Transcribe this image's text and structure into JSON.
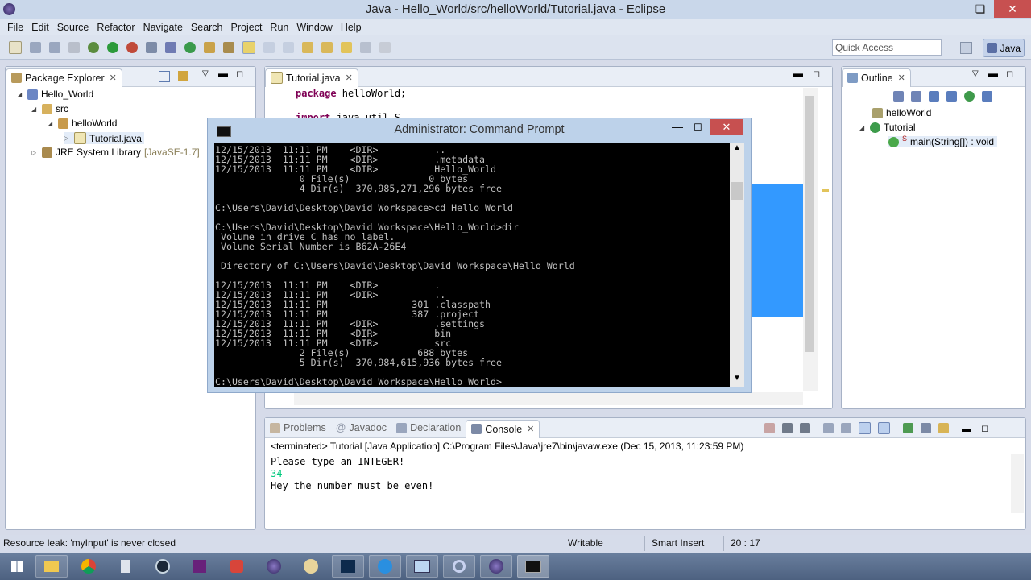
{
  "window": {
    "title": "Java - Hello_World/src/helloWorld/Tutorial.java - Eclipse"
  },
  "menu": [
    "File",
    "Edit",
    "Source",
    "Refactor",
    "Navigate",
    "Search",
    "Project",
    "Run",
    "Window",
    "Help"
  ],
  "toolbar": {
    "quick_access_placeholder": "Quick Access",
    "perspective": "Java"
  },
  "package_explorer": {
    "title": "Package Explorer",
    "items": [
      {
        "label": "Hello_World"
      },
      {
        "label": "src"
      },
      {
        "label": "helloWorld"
      },
      {
        "label": "Tutorial.java"
      },
      {
        "label": "JRE System Library",
        "decoration": "[JavaSE-1.7]"
      }
    ]
  },
  "editor": {
    "tab": "Tutorial.java",
    "lines": [
      {
        "keyword": "package",
        "text": " helloWorld;"
      },
      {
        "keyword": "import",
        "text": " java.util.S"
      }
    ]
  },
  "outline": {
    "title": "Outline",
    "items": [
      {
        "label": "helloWorld"
      },
      {
        "label": "Tutorial"
      },
      {
        "label": "main(String[]) : void",
        "modifier": "S"
      }
    ]
  },
  "command_prompt": {
    "title": "Administrator: Command Prompt",
    "lines": [
      "12/15/2013  11:11 PM    <DIR>          ..",
      "12/15/2013  11:11 PM    <DIR>          .metadata",
      "12/15/2013  11:11 PM    <DIR>          Hello_World",
      "               0 File(s)              0 bytes",
      "               4 Dir(s)  370,985,271,296 bytes free",
      "",
      "C:\\Users\\David\\Desktop\\David Workspace>cd Hello_World",
      "",
      "C:\\Users\\David\\Desktop\\David Workspace\\Hello_World>dir",
      " Volume in drive C has no label.",
      " Volume Serial Number is B62A-26E4",
      "",
      " Directory of C:\\Users\\David\\Desktop\\David Workspace\\Hello_World",
      "",
      "12/15/2013  11:11 PM    <DIR>          .",
      "12/15/2013  11:11 PM    <DIR>          ..",
      "12/15/2013  11:11 PM               301 .classpath",
      "12/15/2013  11:11 PM               387 .project",
      "12/15/2013  11:11 PM    <DIR>          .settings",
      "12/15/2013  11:11 PM    <DIR>          bin",
      "12/15/2013  11:11 PM    <DIR>          src",
      "               2 File(s)            688 bytes",
      "               5 Dir(s)  370,984,615,936 bytes free",
      "",
      "C:\\Users\\David\\Desktop\\David Workspace\\Hello_World>"
    ]
  },
  "bottom_panel": {
    "tabs": [
      "Problems",
      "Javadoc",
      "Declaration",
      "Console"
    ],
    "status_line": "<terminated> Tutorial [Java Application] C:\\Program Files\\Java\\jre7\\bin\\javaw.exe (Dec 15, 2013, 11:23:59 PM)",
    "output": [
      {
        "text": "Please type an INTEGER!",
        "kind": "stdout"
      },
      {
        "text": "34",
        "kind": "stdin"
      },
      {
        "text": "Hey the number must be even!",
        "kind": "stdout"
      }
    ]
  },
  "status_bar": {
    "message": "Resource leak: 'myInput' is never closed",
    "writable": "Writable",
    "insert_mode": "Smart Insert",
    "position": "20 : 17"
  },
  "colors": {
    "stdin_green": "#00c87d",
    "keyword_purple": "#7f0055",
    "selection_blue": "#3399ff"
  }
}
